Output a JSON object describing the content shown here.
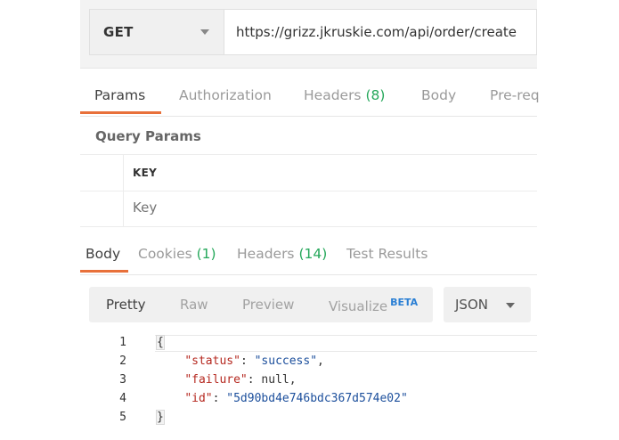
{
  "request": {
    "method": "GET",
    "url": "https://grizz.jkruskie.com/api/order/create"
  },
  "request_tabs": [
    {
      "label": "Params",
      "count": ""
    },
    {
      "label": "Authorization",
      "count": ""
    },
    {
      "label": "Headers",
      "count": "(8)"
    },
    {
      "label": "Body",
      "count": ""
    },
    {
      "label": "Pre-req",
      "count": ""
    }
  ],
  "query_params": {
    "title": "Query Params",
    "column_key": "KEY",
    "key_placeholder": "Key"
  },
  "response_tabs": [
    {
      "label": "Body",
      "count": ""
    },
    {
      "label": "Cookies",
      "count": "(1)"
    },
    {
      "label": "Headers",
      "count": "(14)"
    },
    {
      "label": "Test Results",
      "count": ""
    }
  ],
  "view_tabs": {
    "pretty": "Pretty",
    "raw": "Raw",
    "preview": "Preview",
    "visualize": "Visualize",
    "beta": "BETA"
  },
  "format": "JSON",
  "code": {
    "line_numbers": [
      "1",
      "2",
      "3",
      "4",
      "5"
    ],
    "open_brace": "{",
    "close_brace": "}",
    "status_key": "\"status\"",
    "status_value": "\"success\"",
    "failure_key": "\"failure\"",
    "failure_value": "null",
    "id_key": "\"id\"",
    "id_value": "\"5d90bd4e746bdc367d574e02\""
  },
  "colors": {
    "accent": "#e8703a",
    "count_green": "#26a85b",
    "json_key": "#b5281f",
    "json_string": "#1c4f9c",
    "beta_blue": "#2a7fd4"
  }
}
